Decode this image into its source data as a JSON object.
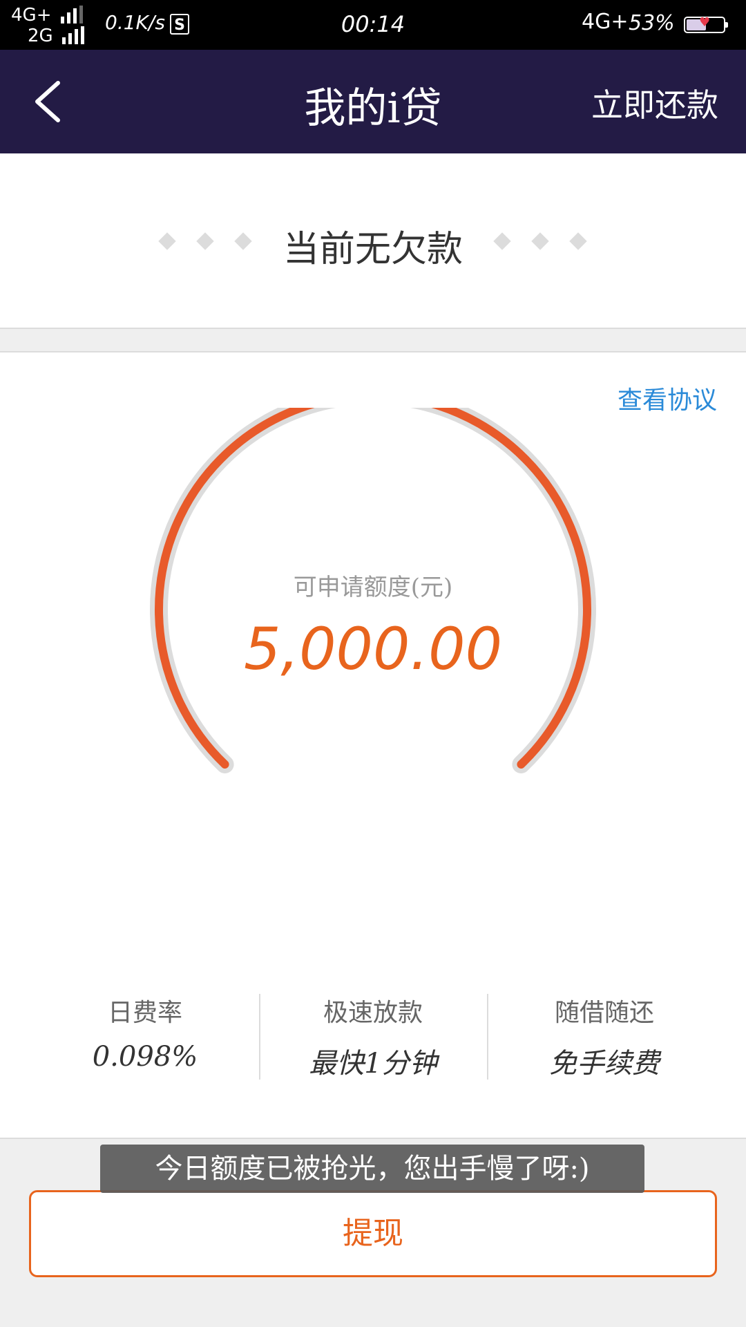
{
  "status_bar": {
    "network_top": "4G+",
    "network_bottom": "2G",
    "speed": "0.1K/s",
    "s_icon": "S",
    "time": "00:14",
    "right_network": "4G+",
    "battery_percent": "53%",
    "battery_level": 0.53
  },
  "header": {
    "title": "我的i贷",
    "repay_label": "立即还款",
    "bg_color": "#231b45"
  },
  "debt": {
    "status_text": "当前无欠款"
  },
  "credit": {
    "agreement_link": "查看协议",
    "label": "可申请额度(元)",
    "amount": "5,000.00",
    "accent_color": "#e8641d"
  },
  "features": [
    {
      "title": "日费率",
      "value": "0.098%"
    },
    {
      "title": "极速放款",
      "value": "最快1分钟"
    },
    {
      "title": "随借随还",
      "value": "免手续费"
    }
  ],
  "toast": {
    "message": "今日额度已被抢光，您出手慢了呀:)"
  },
  "withdraw": {
    "label": "提现"
  }
}
